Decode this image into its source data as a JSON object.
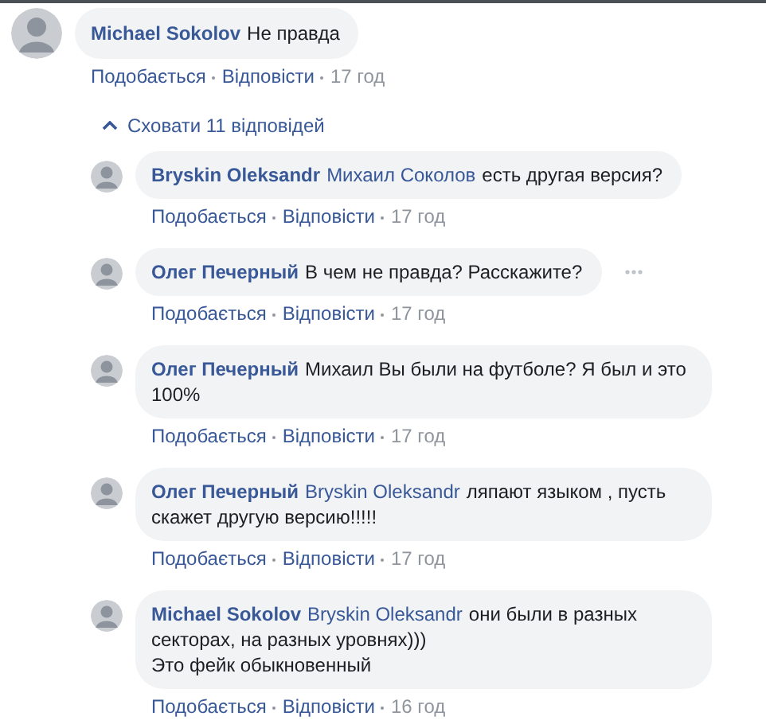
{
  "comment": {
    "author": "Michael Sokolov",
    "lines": [
      "Не правда"
    ],
    "actions": {
      "like": "Подобається",
      "reply": "Відповісти",
      "time": "17 год"
    }
  },
  "toggle_replies": {
    "label": "Сховати 11 відповідей",
    "expanded": true
  },
  "replies": [
    {
      "author": "Bryskin Oleksandr",
      "mention": "Михаил Соколов",
      "lines": [
        "есть другая версия?"
      ],
      "show_menu": false,
      "actions": {
        "like": "Подобається",
        "reply": "Відповісти",
        "time": "17 год"
      }
    },
    {
      "author": "Олег Печерный",
      "lines": [
        "В чем не правда? Расскажите?"
      ],
      "show_menu": true,
      "actions": {
        "like": "Подобається",
        "reply": "Відповісти",
        "time": "17 год"
      }
    },
    {
      "author": "Олег Печерный",
      "lines": [
        "Михаил Вы были на футболе? Я был и это 100%"
      ],
      "show_menu": false,
      "actions": {
        "like": "Подобається",
        "reply": "Відповісти",
        "time": "17 год"
      }
    },
    {
      "author": "Олег Печерный",
      "mention": "Bryskin Oleksandr",
      "lines": [
        "ляпают языком , пусть скажет другую версию!!!!!"
      ],
      "show_menu": false,
      "actions": {
        "like": "Подобається",
        "reply": "Відповісти",
        "time": "17 год"
      }
    },
    {
      "author": "Michael Sokolov",
      "mention": "Bryskin Oleksandr",
      "lines": [
        "они были в разных секторах, на разных уровнях)))",
        "Это фейк обыкновенный"
      ],
      "show_menu": false,
      "actions": {
        "like": "Подобається",
        "reply": "Відповісти",
        "time": "16 год"
      }
    }
  ]
}
